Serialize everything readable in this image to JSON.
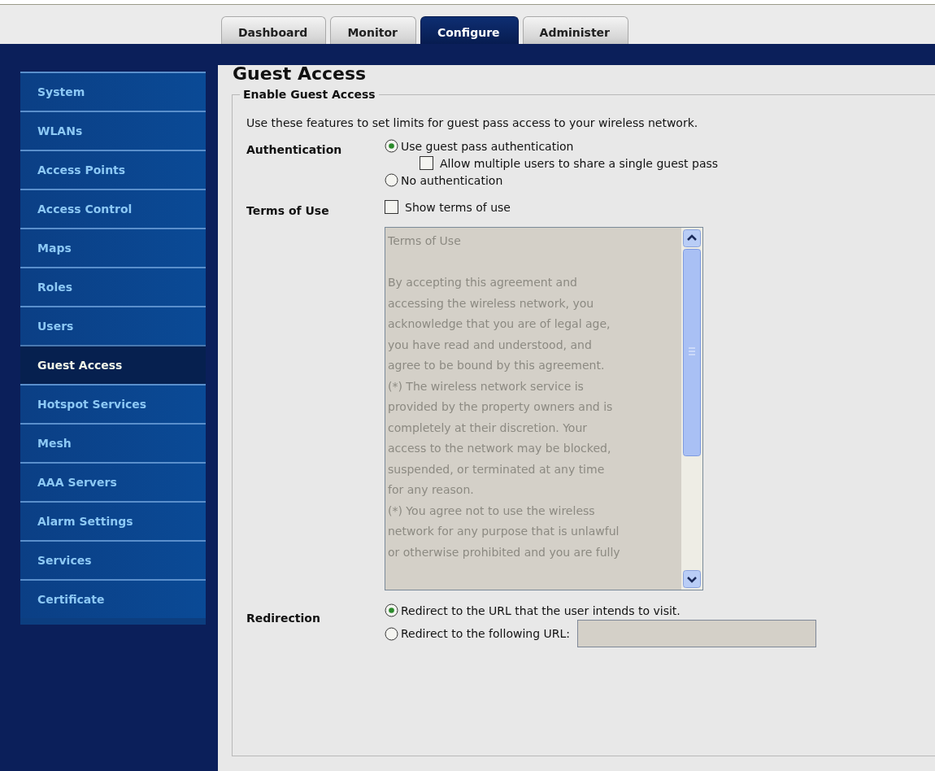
{
  "tabs": [
    {
      "label": "Dashboard",
      "selected": false
    },
    {
      "label": "Monitor",
      "selected": false
    },
    {
      "label": "Configure",
      "selected": true
    },
    {
      "label": "Administer",
      "selected": false
    }
  ],
  "sidebar": {
    "items": [
      {
        "label": "System",
        "selected": false
      },
      {
        "label": "WLANs",
        "selected": false
      },
      {
        "label": "Access Points",
        "selected": false
      },
      {
        "label": "Access Control",
        "selected": false
      },
      {
        "label": "Maps",
        "selected": false
      },
      {
        "label": "Roles",
        "selected": false
      },
      {
        "label": "Users",
        "selected": false
      },
      {
        "label": "Guest Access",
        "selected": true
      },
      {
        "label": "Hotspot Services",
        "selected": false
      },
      {
        "label": "Mesh",
        "selected": false
      },
      {
        "label": "AAA Servers",
        "selected": false
      },
      {
        "label": "Alarm Settings",
        "selected": false
      },
      {
        "label": "Services",
        "selected": false
      },
      {
        "label": "Certificate",
        "selected": false
      }
    ]
  },
  "page": {
    "title": "Guest Access",
    "section": "Enable Guest Access",
    "intro": "Use these features to set limits for guest pass access to your wireless network.",
    "authentication": {
      "label": "Authentication",
      "options": [
        {
          "kind": "radio",
          "label": "Use guest pass authentication",
          "selected": true
        },
        {
          "kind": "checkbox",
          "label": "Allow multiple users to share a single guest pass",
          "checked": false
        },
        {
          "kind": "radio",
          "label": "No authentication",
          "selected": false
        }
      ]
    },
    "terms": {
      "label": "Terms of Use",
      "checkbox": {
        "label": "Show terms of use",
        "checked": false
      },
      "disabled": true,
      "title": "Terms of Use",
      "lines": [
        "By accepting this agreement and",
        "accessing the wireless network, you",
        "acknowledge that you are of legal age,",
        "you have read and understood, and",
        "agree to be bound by this agreement.",
        "(*) The wireless network service is",
        "provided by the property owners and is",
        "completely at their discretion. Your",
        "access to the network may be blocked,",
        "suspended, or terminated at any time",
        "for any reason.",
        "(*) You agree not to use the wireless",
        "network for any purpose that is unlawful",
        "or otherwise prohibited and you are fully"
      ]
    },
    "redirection": {
      "label": "Redirection",
      "options": [
        {
          "label": "Redirect to the URL that the user intends to visit.",
          "selected": true,
          "has_field": false
        },
        {
          "label": "Redirect to the following URL:",
          "selected": false,
          "has_field": true
        }
      ],
      "url_field": {
        "disabled": true
      }
    }
  }
}
